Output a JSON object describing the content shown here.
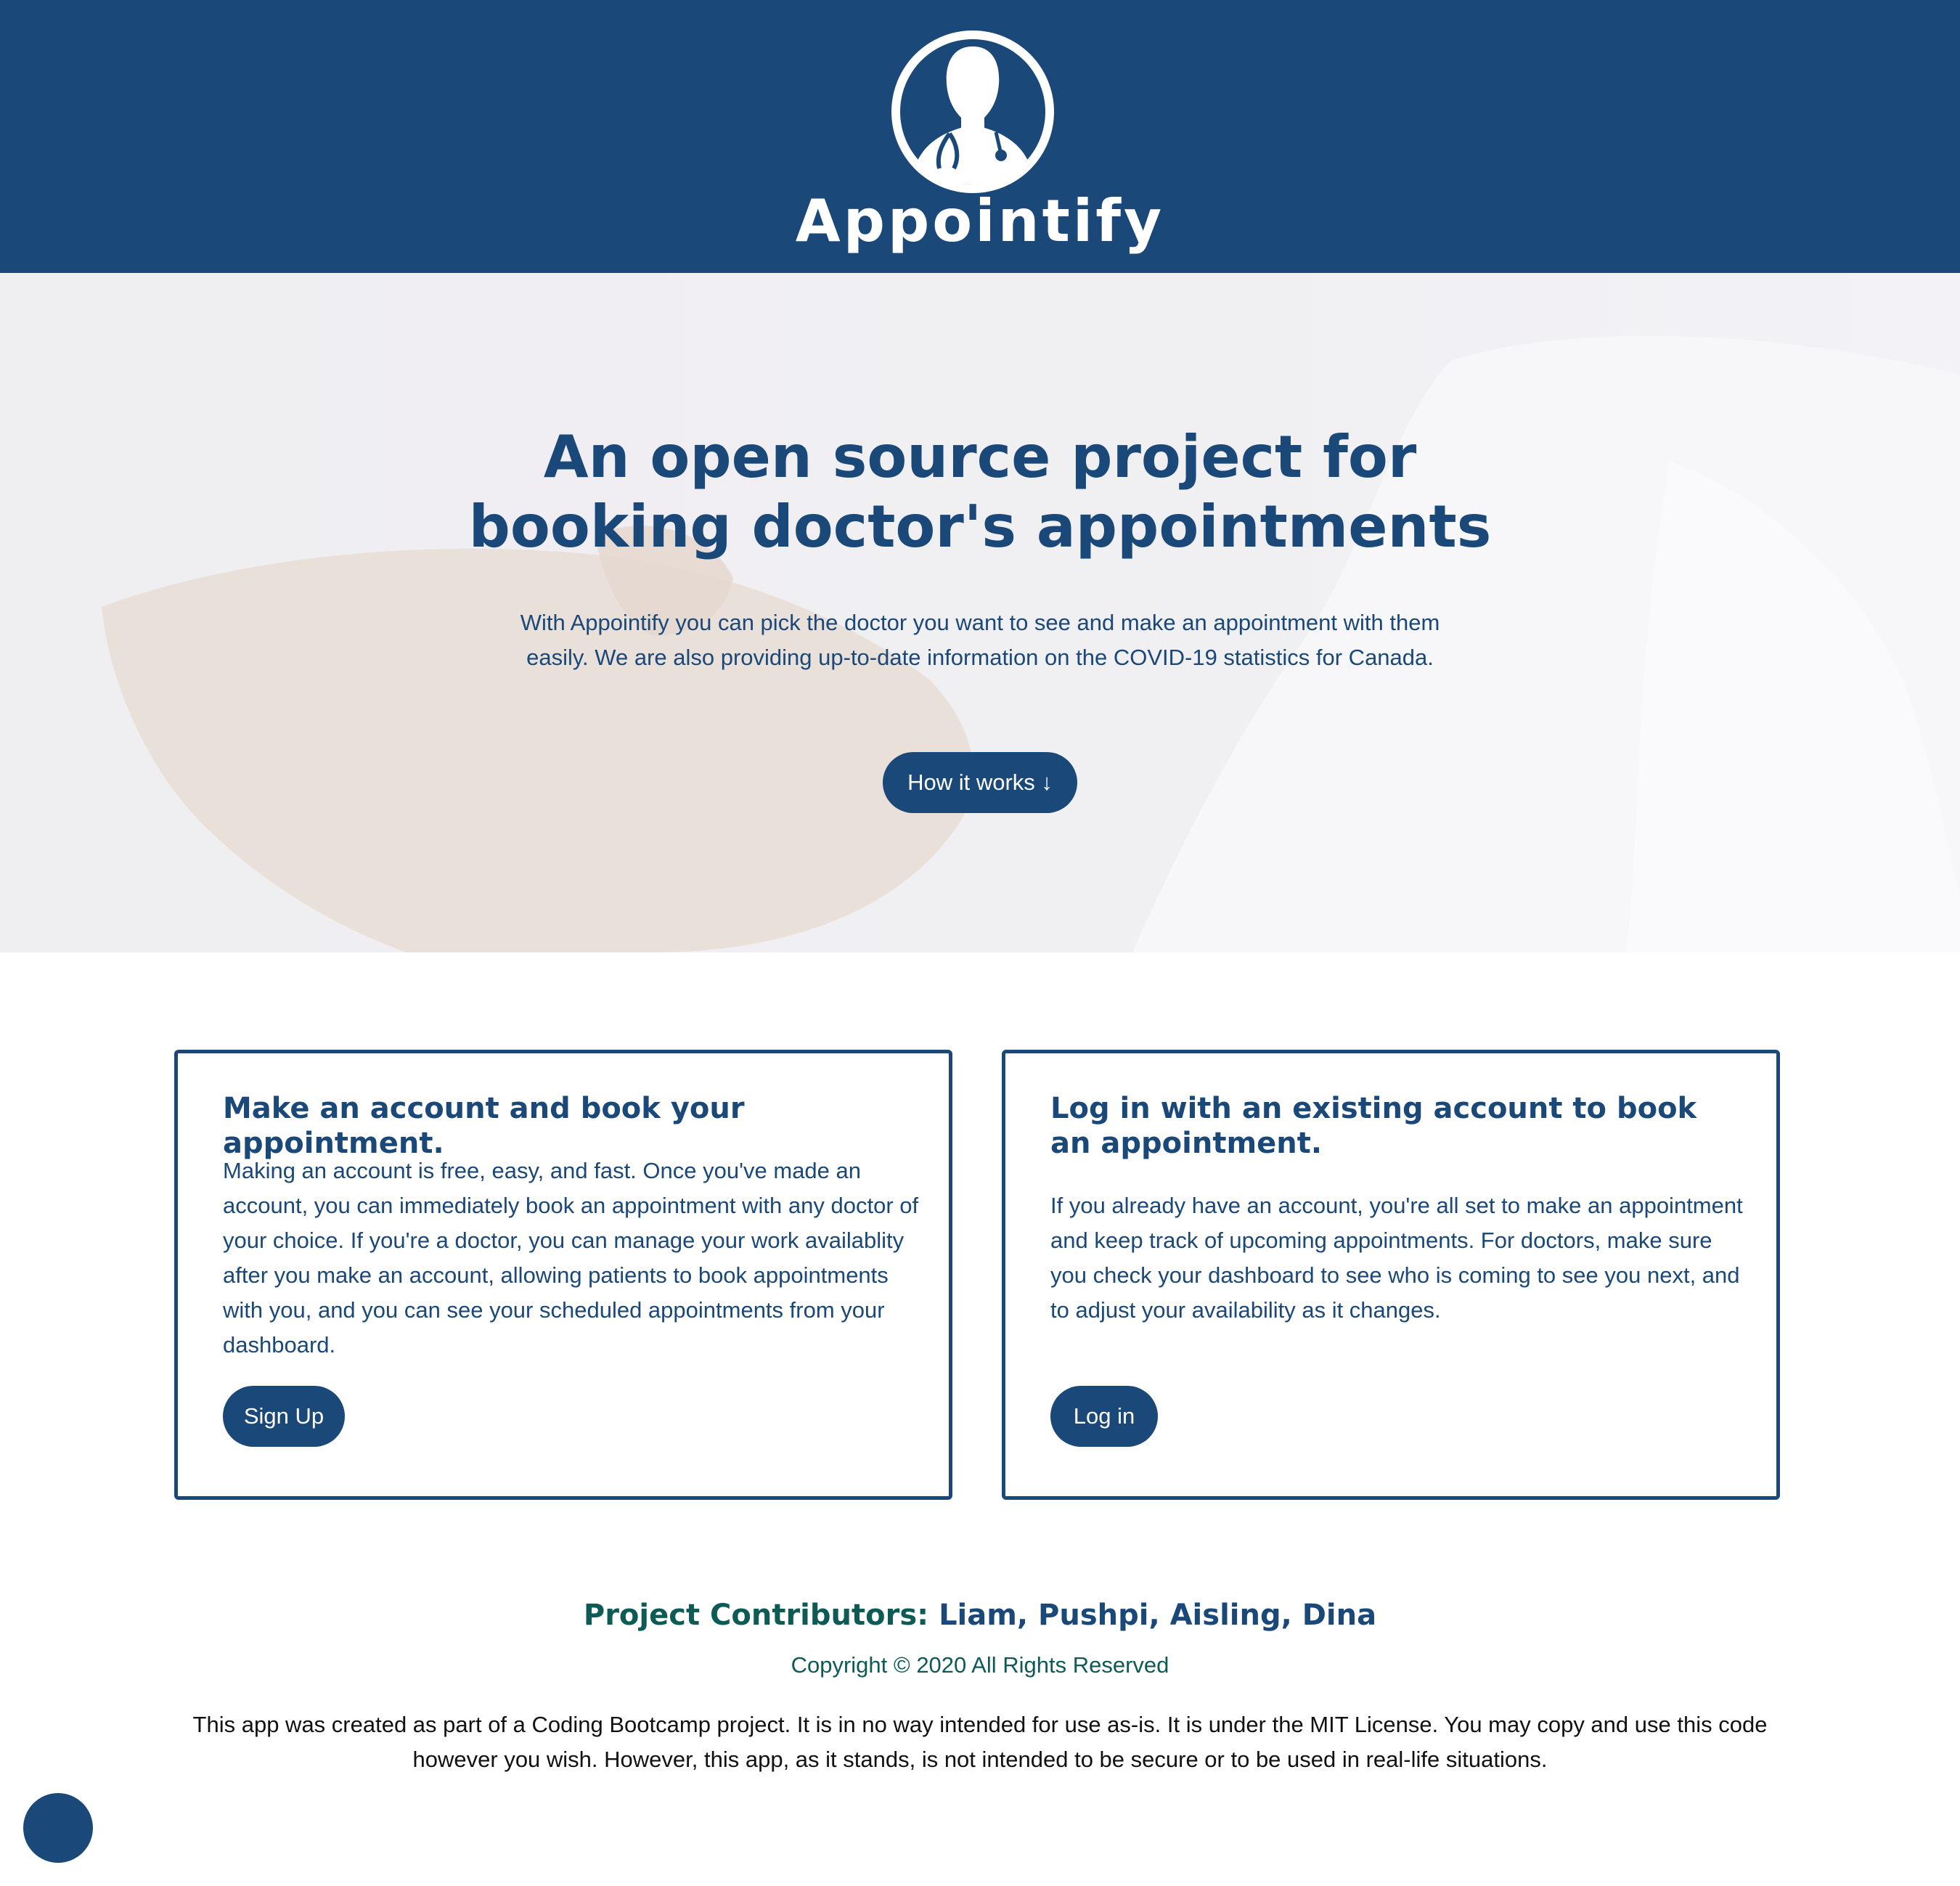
{
  "brand": {
    "name": "Appointify",
    "logo_icon": "doctor-stethoscope-icon"
  },
  "hero": {
    "title_line1": "An open source project for",
    "title_line2": "booking doctor's appointments",
    "description": "With Appointify you can pick the doctor you want to see and make an appointment with them easily. We are also providing up-to-date information on the COVID-19 statistics for Canada.",
    "button_label": "How it works ↓"
  },
  "cards": [
    {
      "title": "Make an account and book your appointment.",
      "body": "Making an account is free, easy, and fast. Once you've made an account, you can immediately book an appointment with any doctor of your choice. If you're a doctor, you can manage your work availablity after you make an account, allowing patients to book appointments with you, and you can see your scheduled appointments from your dashboard.",
      "button_label": "Sign Up"
    },
    {
      "title": "Log in with an existing account to book an appointment.",
      "body": "If you already have an account, you're all set to make an appointment and keep track of upcoming appointments. For doctors, make sure you check your dashboard to see who is coming to see you next, and to adjust your availability as it changes.",
      "button_label": "Log in"
    }
  ],
  "footer": {
    "contributors_label": "Project Contributors:",
    "contributors_names": "Liam, Pushpi, Aisling, Dina",
    "copyright": "Copyright © 2020 All Rights Reserved",
    "note": "This app was created as part of a Coding Bootcamp project. It is in no way intended for use as-is. It is under the MIT License. You may copy and use this code however you wish. However, this app, as it stands, is not intended to be secure or to be used in real-life situations."
  },
  "colors": {
    "primary": "#1a4878",
    "teal": "#0e5a55",
    "hero_bg": "#efeef1"
  }
}
